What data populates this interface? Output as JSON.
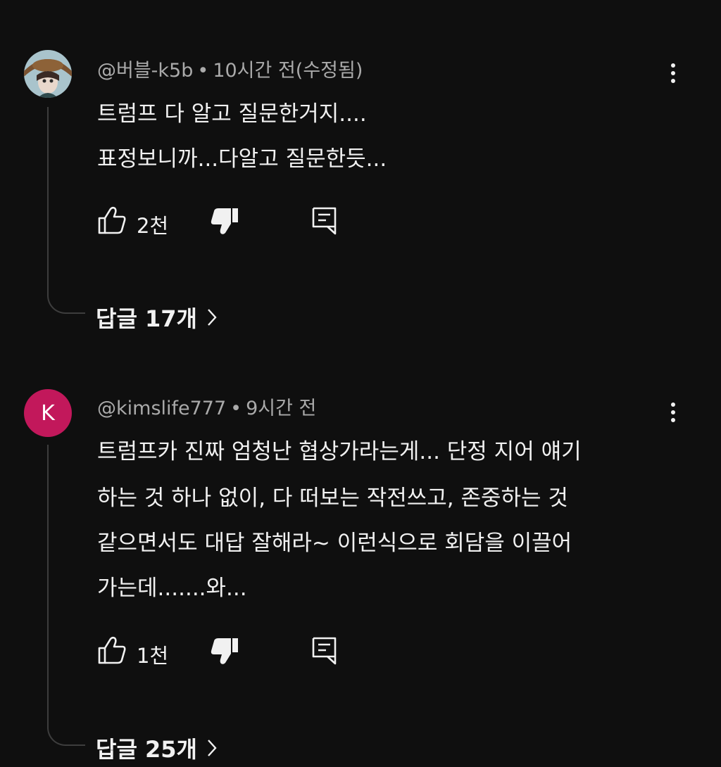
{
  "comments": [
    {
      "author": "@버블-k5b",
      "separator": "•",
      "time": "10시간 전(수정됨)",
      "avatar": "profile-illustration",
      "lines": [
        "트럼프 다 알고 질문한거지....",
        "표정보니까...다알고 질문한듯..."
      ],
      "likes": "2천",
      "replies": "답글 17개"
    },
    {
      "author": "@kimslife777",
      "separator": "•",
      "time": "9시간 전",
      "avatar": "K",
      "avatar_color": "#c2185b",
      "lines": [
        "트럼프카 진짜 엄청난 협상가라는게... 단정 지어 얘기",
        "하는 것 하나 없이, 다 떠보는 작전쓰고, 존중하는 것",
        "같으면서도 대답 잘해라~ 이런식으로 회담을 이끌어",
        "가는데.......와..."
      ],
      "likes": "1천",
      "replies": "답글 25개"
    }
  ],
  "icons": {
    "like": "thumbs-up-icon",
    "dislike": "thumbs-down-icon",
    "reply": "comment-icon",
    "more": "more-vertical-icon",
    "chevron": "chevron-right-icon"
  },
  "colors": {
    "background": "#0f0f0f",
    "text": "#f1f1f1",
    "meta": "#aaaaaa",
    "thread_line": "#3d3d3d"
  }
}
